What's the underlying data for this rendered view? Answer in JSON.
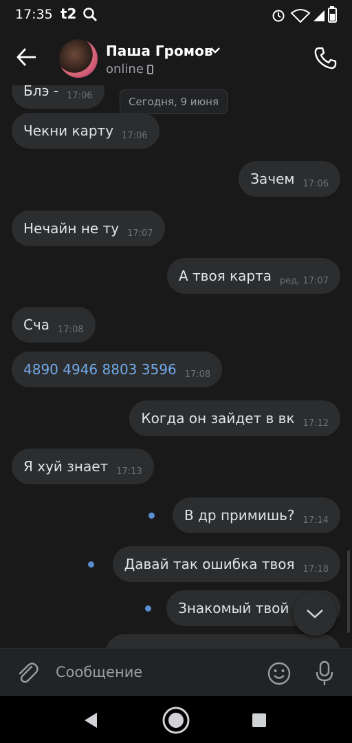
{
  "status_bar": {
    "time": "17:35",
    "carrier": "t2"
  },
  "header": {
    "name": "Паша Громов",
    "status": "online"
  },
  "date_separator": "Сегодня, 9 июня",
  "messages": [
    {
      "text": "Блэ -",
      "time": "17:06",
      "side": "in"
    },
    {
      "text": "Чекни карту",
      "time": "17:06",
      "side": "in"
    },
    {
      "text": "Зачем",
      "time": "17:06",
      "side": "out"
    },
    {
      "text": "Нечайн не ту",
      "time": "17:07",
      "side": "in"
    },
    {
      "text": "А твоя карта",
      "time": "ред. 17:07",
      "side": "out"
    },
    {
      "text": "Сча",
      "time": "17:08",
      "side": "in"
    },
    {
      "text": "4890 4946 8803 3596",
      "time": "17:08",
      "side": "in"
    },
    {
      "text": "Когда он зайдет в вк",
      "time": "17:12",
      "side": "out"
    },
    {
      "text": "Я хуй знает",
      "time": "17:13",
      "side": "in"
    },
    {
      "text": "В др примишь?",
      "time": "17:14",
      "side": "out"
    },
    {
      "text": "Давай так ошибка твоя",
      "time": "17:18",
      "side": "out"
    },
    {
      "text": "Знакомый твой",
      "time": "",
      "side": "out"
    }
  ],
  "composer": {
    "placeholder": "Сообщение"
  },
  "colors": {
    "background": "#19191a",
    "bubble": "#2c2d2e",
    "link": "#71aaeb",
    "unread_dot": "#5a8dcf"
  }
}
